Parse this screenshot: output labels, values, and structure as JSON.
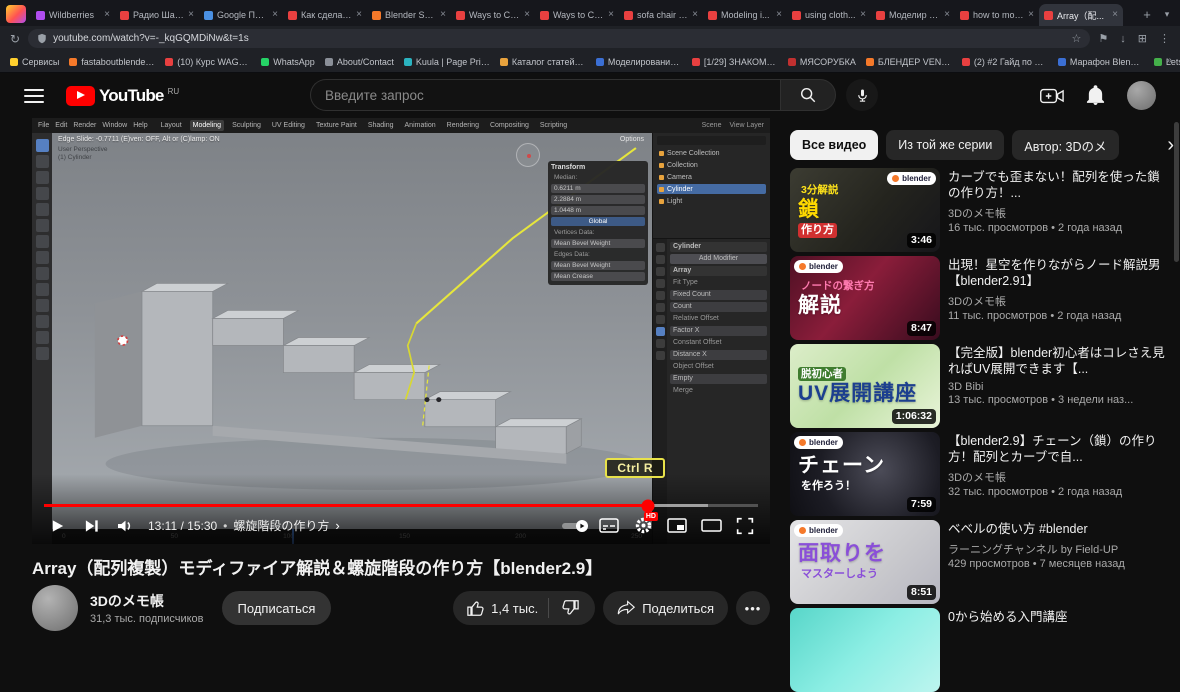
{
  "browser": {
    "tabs": [
      {
        "label": "Wildberries",
        "color": "#b14df0",
        "cls": ""
      },
      {
        "label": "Радио Шан...",
        "color": "#e84040",
        "cls": ""
      },
      {
        "label": "Google Пер...",
        "color": "#4a90e2",
        "cls": ""
      },
      {
        "label": "Как сделал...",
        "color": "#e84040",
        "cls": ""
      },
      {
        "label": "Blender Sec...",
        "color": "#f5792a",
        "cls": ""
      },
      {
        "label": "Ways to Cr...",
        "color": "#e84040",
        "cls": ""
      },
      {
        "label": "Ways to Cre...",
        "color": "#e84040",
        "cls": ""
      },
      {
        "label": "sofa chair m...",
        "color": "#e84040",
        "cls": ""
      },
      {
        "label": "Modeling i...",
        "color": "#e84040",
        "cls": ""
      },
      {
        "label": "using cloth...",
        "color": "#e84040",
        "cls": ""
      },
      {
        "label": "Моделир и...",
        "color": "#e84040",
        "cls": ""
      },
      {
        "label": "how to mod...",
        "color": "#e84040",
        "cls": ""
      },
      {
        "label": "Array（配...",
        "color": "#e84040",
        "cls": "active"
      }
    ],
    "url": "youtube.com/watch?v=-_kqGQMDiNw&t=1s",
    "bookmarks": [
      {
        "label": "Сервисы",
        "color": "#ffd02e"
      },
      {
        "label": "fastaboutblender...",
        "color": "#f5792a"
      },
      {
        "label": "(10) Курс WAGON...",
        "color": "#e84040"
      },
      {
        "label": "WhatsApp",
        "color": "#25d366"
      },
      {
        "label": "About/Contact",
        "color": "#8a8f98"
      },
      {
        "label": "Kuula | Page Pricing",
        "color": "#2bb3c0"
      },
      {
        "label": "Каталог статей - П...",
        "color": "#e8a23d"
      },
      {
        "label": "Моделирование и...",
        "color": "#3b6fd4"
      },
      {
        "label": "[1/29] ЗНАКОМСТВ...",
        "color": "#e84040"
      },
      {
        "label": "МЯСОРУБКА",
        "color": "#c03030"
      },
      {
        "label": "БЛЕНДЕР VENTALL...",
        "color": "#f5792a"
      },
      {
        "label": "(2) #2 Гайд по Blen...",
        "color": "#e84040"
      },
      {
        "label": "Марафон Blender...",
        "color": "#3b6fd4"
      },
      {
        "label": "LetsPlayOverGame...",
        "color": "#44b04a"
      }
    ]
  },
  "header": {
    "logo_text": "YouTube",
    "logo_region": "RU",
    "search_placeholder": "Введите запрос"
  },
  "player": {
    "blender": {
      "menus": [
        "File",
        "Edit",
        "Render",
        "Window",
        "Help"
      ],
      "workspaces": [
        "Layout",
        "Modeling",
        "Sculpting",
        "UV Editing",
        "Texture Paint",
        "Shading",
        "Animation",
        "Rendering",
        "Compositing",
        "Scripting"
      ],
      "scene": "Scene",
      "view_layer": "View Layer",
      "status": "Edge Slide: -0.7711  (E)ven: OFF, Alt or (C)lamp: ON",
      "view_label": "User Perspective",
      "object_label": "(1) Cylinder",
      "options": "Options",
      "tools": [
        "select",
        "cursor",
        "move",
        "rotate",
        "scale",
        "transform",
        "annotate",
        "measure",
        "add-cube",
        "extrude",
        "inset",
        "bevel",
        "loop-cut",
        "knife"
      ],
      "transform": {
        "title": "Transform",
        "rows": [
          {
            "label": "Median:",
            "cls": "lbl"
          },
          {
            "label": "0.6211 m",
            "cls": "fld"
          },
          {
            "label": "2.2884 m",
            "cls": "fld"
          },
          {
            "label": "1.0448 m",
            "cls": "fld"
          },
          {
            "label": "Global",
            "cls": "btn"
          },
          {
            "label": "Vertices Data:",
            "cls": "lbl"
          },
          {
            "label": "Mean Bevel Weight",
            "cls": "fld"
          },
          {
            "label": "Edges Data:",
            "cls": "lbl"
          },
          {
            "label": "Mean Bevel Weight",
            "cls": "fld"
          },
          {
            "label": "Mean Crease",
            "cls": "fld"
          }
        ]
      },
      "outliner": [
        {
          "label": "Scene Collection",
          "cls": ""
        },
        {
          "label": "Collection",
          "cls": ""
        },
        {
          "label": "Camera",
          "cls": ""
        },
        {
          "label": "Cylinder",
          "cls": "hl"
        },
        {
          "label": "Light",
          "cls": ""
        }
      ],
      "properties": [
        {
          "label": "Cylinder",
          "cls": "hdr"
        },
        {
          "label": "Add Modifier",
          "cls": "btn"
        },
        {
          "label": "Array",
          "cls": "hdr"
        },
        {
          "label": "Fit Type",
          "cls": "lbl"
        },
        {
          "label": "Fixed Count",
          "cls": "fld"
        },
        {
          "label": "Count",
          "cls": "fld"
        },
        {
          "label": "Relative Offset",
          "cls": "lbl"
        },
        {
          "label": "Factor X",
          "cls": "fld"
        },
        {
          "label": "Constant Offset",
          "cls": "lbl"
        },
        {
          "label": "Distance X",
          "cls": "fld"
        },
        {
          "label": "Object Offset",
          "cls": "lbl"
        },
        {
          "label": "Empty",
          "cls": "fld"
        },
        {
          "label": "Merge",
          "cls": "lbl"
        }
      ],
      "timeline_ticks": [
        "0",
        "50",
        "100",
        "150",
        "200",
        "250"
      ],
      "key_overlay": "Ctrl R"
    },
    "controls": {
      "time": "13:11 / 15:30",
      "chapter": "螺旋階段の作り方",
      "hd": "HD",
      "progress_played": "84.6%",
      "progress_buffered": "93%"
    }
  },
  "video": {
    "title": "Array（配列複製）モディファイア解説＆螺旋階段の作り方【blender2.9】",
    "channel_name": "3Dのメモ帳",
    "channel_subs": "31,3 тыс. подписчиков",
    "subscribe": "Подписаться",
    "likes": "1,4 тыс.",
    "share": "Поделиться"
  },
  "sidebar": {
    "chips": [
      {
        "label": "Все видео",
        "cls": "on"
      },
      {
        "label": "Из той же серии",
        "cls": ""
      },
      {
        "label": "Автор: 3Dのメ",
        "cls": ""
      }
    ],
    "videos": [
      {
        "duration": "3:46",
        "title": "カーブでも歪まない！配列を使った鎖の作り方！...",
        "channel": "3Dのメモ帳",
        "meta": "16 тыс. просмотров • 2 года назад",
        "thumb": {
          "bg": "linear-gradient(130deg,#3c3c32 0%,#24241e 55%,#16161a 100%)",
          "t1": "3分解説",
          "t1c": "#ffe31a",
          "t1bg": "transparent",
          "t2": "鎖",
          "t2c": "#ffd900",
          "t3": "作り方",
          "t3c": "#ffffff",
          "t3bg": "#d03030",
          "badge": "blender",
          "badge_cls": "tr"
        }
      },
      {
        "duration": "8:47",
        "title": "出現！星空を作りながらノード解説男【blender2.91】",
        "channel": "3Dのメモ帳",
        "meta": "11 тыс. просмотров • 2 года назад",
        "thumb": {
          "bg": "linear-gradient(130deg,#4e1024 0%,#8a1d3a 45%,#380c1e 100%)",
          "t1": "ノードの繋ぎ方",
          "t1c": "#ff7ab0",
          "t1bg": "transparent",
          "t2": "解説",
          "t2c": "#ffffff",
          "t3": "",
          "t3c": "#ffffff",
          "t3bg": "transparent",
          "badge": "blender",
          "badge_cls": "tl"
        }
      },
      {
        "duration": "1:06:32",
        "title": "【完全版】blender初心者はコレさえ見ればUV展開できます【...",
        "channel": "3D Bibi",
        "meta": "13 тыс. просмотров • 3 недели наз...",
        "thumb": {
          "bg": "linear-gradient(135deg,#dcedc9 0%,#bfe0a6 50%,#e9f4d9 100%)",
          "t1": "脱初心者",
          "t1c": "#ffffff",
          "t1bg": "#3f7d2f",
          "t2": "UV展開講座",
          "t2c": "#1c3f8f",
          "t3": "",
          "t3c": "#ffffff",
          "t3bg": "transparent",
          "badge": "",
          "badge_cls": "hide"
        }
      },
      {
        "duration": "7:59",
        "title": "【blender2.9】チェーン（鎖）の作り方！配列とカーブで自...",
        "channel": "3Dのメモ帳",
        "meta": "32 тыс. просмотров • 2 года назад",
        "thumb": {
          "bg": "radial-gradient(circle at 60% 45%,#4c4c58 0%,#1c1c24 60%,#0f0f14 100%)",
          "t1": "",
          "t1c": "#ffffff",
          "t1bg": "transparent",
          "t2": "チェーン",
          "t2c": "#ffffff",
          "t3": "を作ろう！",
          "t3c": "#ffffff",
          "t3bg": "transparent",
          "badge": "blender",
          "badge_cls": "tl"
        }
      },
      {
        "duration": "8:51",
        "title": "ベベルの使い方 #blender",
        "channel": "ラーニングチャンネル by Field-UP",
        "meta": "429 просмотров • 7 месяцев назад",
        "thumb": {
          "bg": "linear-gradient(135deg,#e4e4e6 0%,#c9c9cd 60%,#b6b6c0 100%)",
          "t1": "",
          "t1c": "#8a4fd8",
          "t1bg": "transparent",
          "t2": "面取りを",
          "t2c": "#8a4fd8",
          "t3": "マスターしよう",
          "t3c": "#8a4fd8",
          "t3bg": "transparent",
          "badge": "blender",
          "badge_cls": "tl"
        }
      },
      {
        "duration": "",
        "title": "0から始める入門講座",
        "channel": "",
        "meta": "",
        "thumb": {
          "bg": "linear-gradient(135deg,#58d6c9 0%,#8ceee4 50%,#bdf5ef 100%)",
          "t1": "",
          "t1c": "#ffffff",
          "t1bg": "transparent",
          "t2": "",
          "t2c": "#ffffff",
          "t3": "",
          "t3c": "#ffffff",
          "t3bg": "transparent",
          "badge": "",
          "badge_cls": "hide"
        }
      }
    ]
  }
}
